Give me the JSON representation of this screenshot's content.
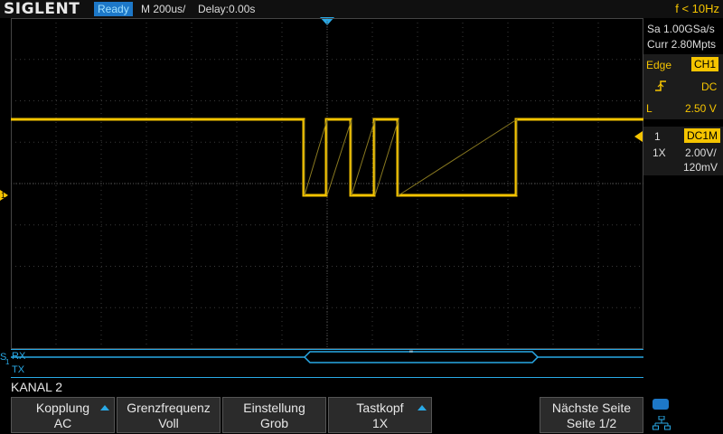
{
  "topbar": {
    "brand": "SIGLENT",
    "status": "Ready",
    "timebase": "M 200us/",
    "delay": "Delay:0.00s",
    "frequency": "f < 10Hz"
  },
  "acquisition": {
    "sample_rate": "Sa 1.00GSa/s",
    "memory_depth": "Curr 2.80Mpts"
  },
  "trigger": {
    "type": "Edge",
    "source": "CH1",
    "slope_icon": "rising-edge-icon",
    "coupling": "DC",
    "level_label": "L",
    "level": "2.50 V"
  },
  "channel1": {
    "number": "1",
    "coupling": "DC1M",
    "probe": "1X",
    "scale": "2.00V/",
    "offset": "120mV",
    "marker": "1"
  },
  "serial": {
    "prefix": "S",
    "index": "1",
    "rx_label": "RX",
    "tx_label": "TX",
    "decoded_value": "\""
  },
  "menu": {
    "title": "KANAL 2",
    "softkeys": [
      {
        "label": "Kopplung",
        "value": "AC"
      },
      {
        "label": "Grenzfrequenz",
        "value": "Voll"
      },
      {
        "label": "Einstellung",
        "value": "Grob"
      },
      {
        "label": "Tastkopf",
        "value": "1X"
      },
      {
        "label": "Nächste Seite",
        "value": "Seite 1/2"
      }
    ]
  },
  "icons": {
    "usb": "usb-icon",
    "network": "network-icon"
  },
  "colors": {
    "channel1": "#f5c400",
    "accent": "#29a9e6",
    "status_bg": "#1d78c8"
  }
}
